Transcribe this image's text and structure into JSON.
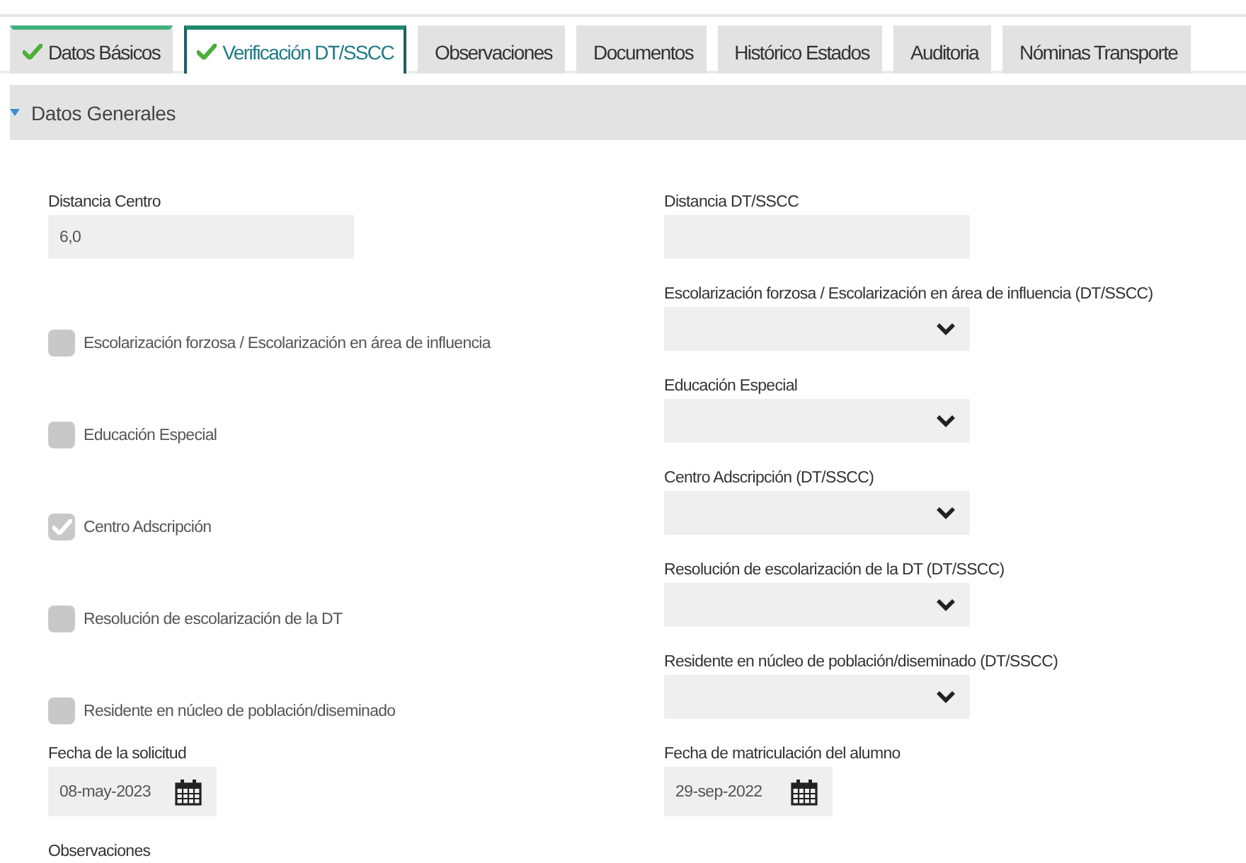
{
  "tabs": [
    {
      "label": "Datos Básicos",
      "selected": false,
      "completed": true
    },
    {
      "label": "Verificación DT/SSCC",
      "selected": true,
      "completed": true
    },
    {
      "label": "Observaciones",
      "selected": false,
      "completed": false
    },
    {
      "label": "Documentos",
      "selected": false,
      "completed": false
    },
    {
      "label": "Histórico Estados",
      "selected": false,
      "completed": false
    },
    {
      "label": "Auditoria",
      "selected": false,
      "completed": false
    },
    {
      "label": "Nóminas Transporte",
      "selected": false,
      "completed": false
    }
  ],
  "section": {
    "title": "Datos Generales",
    "expanded": true
  },
  "left_fields": [
    {
      "kind": "text",
      "label": "Distancia Centro",
      "value": "6,0"
    },
    {
      "kind": "checkbox",
      "label": "Escolarización forzosa / Escolarización en área de influencia",
      "checked": false
    },
    {
      "kind": "checkbox",
      "label": "Educación Especial",
      "checked": false
    },
    {
      "kind": "checkbox",
      "label": "Centro Adscripción",
      "checked": true
    },
    {
      "kind": "checkbox",
      "label": "Resolución de escolarización de la DT",
      "checked": false
    },
    {
      "kind": "checkbox",
      "label": "Residente en núcleo de población/diseminado",
      "checked": false
    },
    {
      "kind": "date",
      "label": "Fecha de la solicitud",
      "value": "08-may-2023"
    },
    {
      "kind": "heading",
      "label": "Observaciones"
    }
  ],
  "right_fields": [
    {
      "kind": "text",
      "label": "Distancia DT/SSCC"
    },
    {
      "kind": "select",
      "label": "Escolarización forzosa / Escolarización en área de influencia (DT/SSCC)"
    },
    {
      "kind": "select",
      "label": "Educación Especial"
    },
    {
      "kind": "select",
      "label": "Centro Adscripción (DT/SSCC)"
    },
    {
      "kind": "select",
      "label": "Resolución de escolarización de la DT (DT/SSCC)"
    },
    {
      "kind": "select",
      "label": "Residente en núcleo de población/diseminado (DT/SSCC)"
    },
    {
      "kind": "date",
      "label": "Fecha de matriculación del alumno",
      "value": "29-sep-2022"
    }
  ]
}
